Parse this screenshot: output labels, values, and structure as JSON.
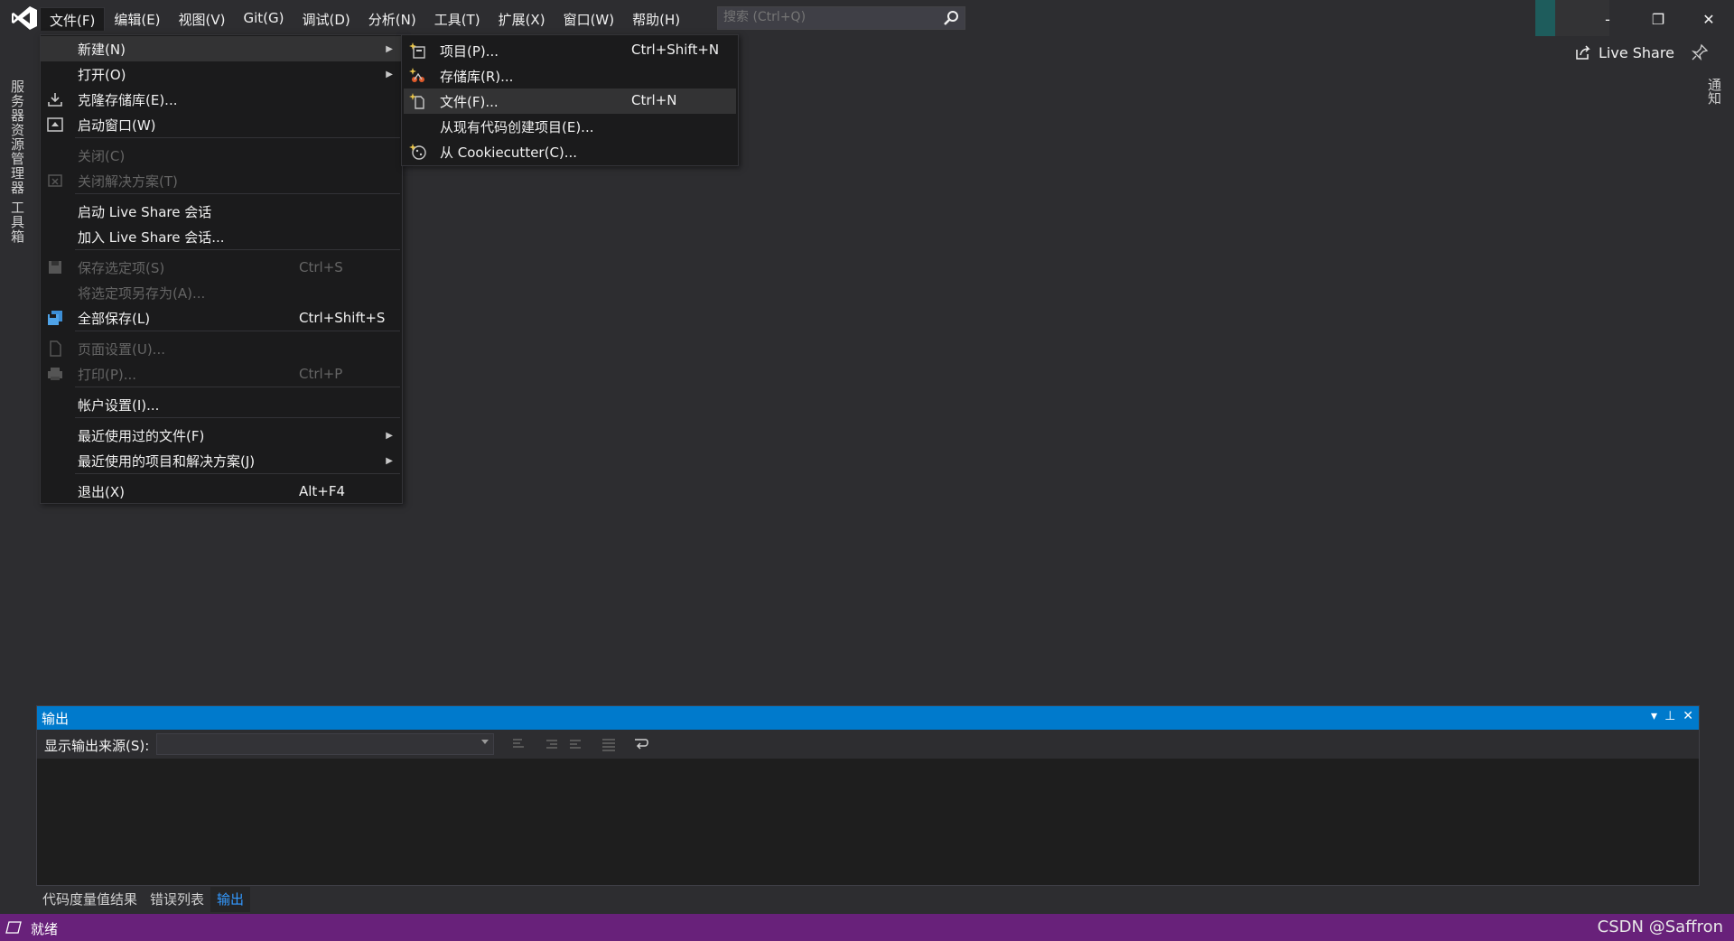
{
  "menubar": {
    "items": [
      "文件(F)",
      "编辑(E)",
      "视图(V)",
      "Git(G)",
      "调试(D)",
      "分析(N)",
      "工具(T)",
      "扩展(X)",
      "窗口(W)",
      "帮助(H)"
    ],
    "active_index": 0
  },
  "search": {
    "placeholder": "搜索 (Ctrl+Q)"
  },
  "window_controls": {
    "minimize": "-",
    "restore": "❐",
    "close": "✕"
  },
  "liveshare": {
    "label": "Live Share"
  },
  "left_rail": {
    "tabs": [
      "服务器资源管理器",
      "工具箱"
    ]
  },
  "right_rail": {
    "tab": "通知"
  },
  "file_menu": {
    "items": [
      {
        "label": "新建(N)",
        "shortcut": "",
        "submenu": true,
        "disabled": false,
        "icon": "none"
      },
      {
        "label": "打开(O)",
        "shortcut": "",
        "submenu": true,
        "disabled": false,
        "icon": "none"
      },
      {
        "label": "克隆存储库(E)...",
        "shortcut": "",
        "submenu": false,
        "disabled": false,
        "icon": "download-icon"
      },
      {
        "label": "启动窗口(W)",
        "shortcut": "",
        "submenu": false,
        "disabled": false,
        "icon": "start-window-icon"
      },
      {
        "label": "关闭(C)",
        "shortcut": "",
        "submenu": false,
        "disabled": true,
        "icon": "none"
      },
      {
        "label": "关闭解决方案(T)",
        "shortcut": "",
        "submenu": false,
        "disabled": true,
        "icon": "close-solution-icon"
      },
      {
        "label": "启动 Live Share 会话",
        "shortcut": "",
        "submenu": false,
        "disabled": false,
        "icon": "none"
      },
      {
        "label": "加入 Live Share 会话...",
        "shortcut": "",
        "submenu": false,
        "disabled": false,
        "icon": "none"
      },
      {
        "label": "保存选定项(S)",
        "shortcut": "Ctrl+S",
        "submenu": false,
        "disabled": true,
        "icon": "save-icon"
      },
      {
        "label": "将选定项另存为(A)...",
        "shortcut": "",
        "submenu": false,
        "disabled": true,
        "icon": "none"
      },
      {
        "label": "全部保存(L)",
        "shortcut": "Ctrl+Shift+S",
        "submenu": false,
        "disabled": false,
        "icon": "save-all-icon"
      },
      {
        "label": "页面设置(U)...",
        "shortcut": "",
        "submenu": false,
        "disabled": true,
        "icon": "page-setup-icon"
      },
      {
        "label": "打印(P)...",
        "shortcut": "Ctrl+P",
        "submenu": false,
        "disabled": true,
        "icon": "print-icon"
      },
      {
        "label": "帐户设置(I)...",
        "shortcut": "",
        "submenu": false,
        "disabled": false,
        "icon": "none"
      },
      {
        "label": "最近使用过的文件(F)",
        "shortcut": "",
        "submenu": true,
        "disabled": false,
        "icon": "none"
      },
      {
        "label": "最近使用的项目和解决方案(J)",
        "shortcut": "",
        "submenu": true,
        "disabled": false,
        "icon": "none"
      },
      {
        "label": "退出(X)",
        "shortcut": "Alt+F4",
        "submenu": false,
        "disabled": false,
        "icon": "none"
      }
    ]
  },
  "new_submenu": {
    "items": [
      {
        "label": "项目(P)...",
        "shortcut": "Ctrl+Shift+N",
        "icon": "new-project-icon"
      },
      {
        "label": "存储库(R)...",
        "shortcut": "",
        "icon": "new-repository-icon"
      },
      {
        "label": "文件(F)...",
        "shortcut": "Ctrl+N",
        "icon": "new-file-icon"
      },
      {
        "label": "从现有代码创建项目(E)...",
        "shortcut": "",
        "icon": "none"
      },
      {
        "label": "从 Cookiecutter(C)...",
        "shortcut": "",
        "icon": "cookiecutter-icon"
      }
    ],
    "hover_index": 2
  },
  "output": {
    "title": "输出",
    "source_label": "显示输出来源(S):",
    "source_value": ""
  },
  "bottom_tabs": [
    "代码度量值结果",
    "错误列表",
    "输出"
  ],
  "bottom_active_index": 2,
  "status": {
    "text": "就绪"
  },
  "watermark": "CSDN @Saffron",
  "colors": {
    "accent": "#007acc",
    "statusbar": "#68217a",
    "background": "#2d2d30",
    "menu_bg": "#1b1b1c"
  }
}
